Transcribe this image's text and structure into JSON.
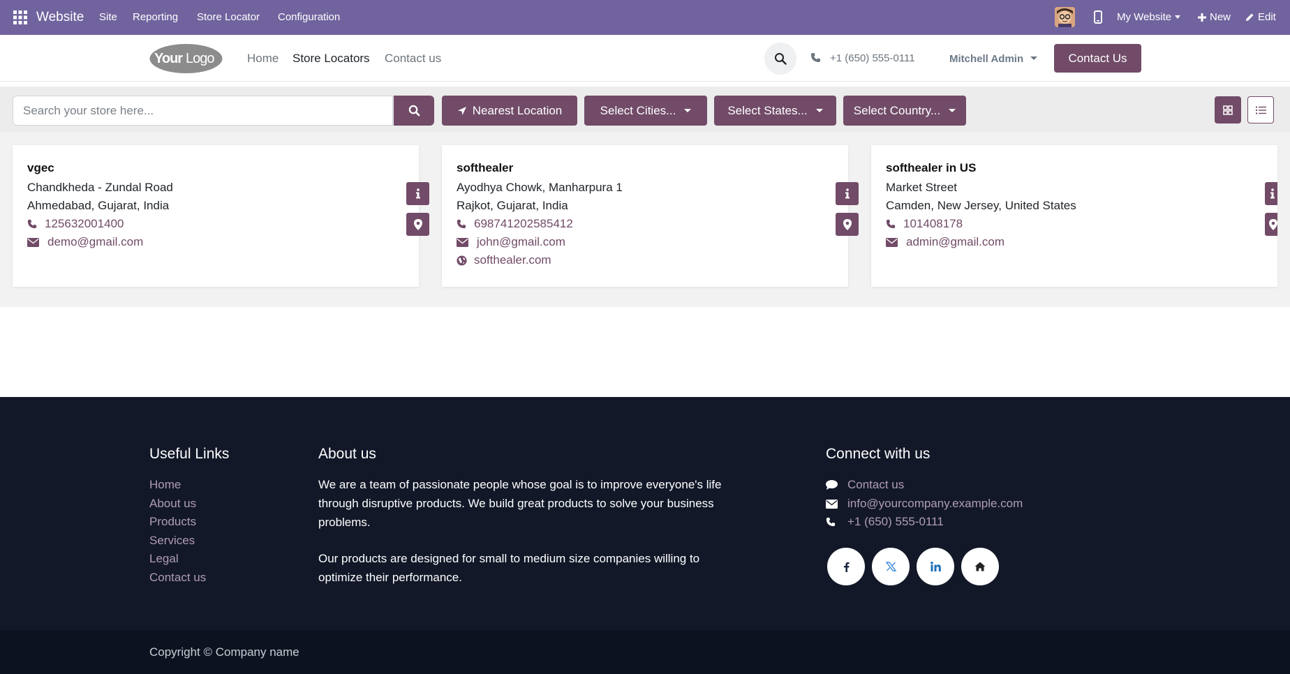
{
  "topbar": {
    "app_name": "Website",
    "menu": [
      "Site",
      "Reporting",
      "Store Locator",
      "Configuration"
    ],
    "website_selector": "My Website",
    "new_label": "New",
    "edit_label": "Edit",
    "bg_color": "#71639e"
  },
  "header": {
    "logo_text": "YourLogo",
    "nav": [
      "Home",
      "Store Locators",
      "Contact us"
    ],
    "active_nav": "Store Locators",
    "phone": "+1 (650) 555-0111",
    "user": "Mitchell Admin",
    "contact_button": "Contact Us"
  },
  "filters": {
    "search_placeholder": "Search your store here...",
    "nearest_label": "Nearest Location",
    "cities_label": "Select Cities...",
    "states_label": "Select States...",
    "country_label": "Select Country..."
  },
  "stores": [
    {
      "name": "vgec",
      "street": "Chandkheda - Zundal Road",
      "city_line": "Ahmedabad, Gujarat, India",
      "phone": "125632001400",
      "email": "demo@gmail.com"
    },
    {
      "name": "softhealer",
      "street": "Ayodhya Chowk, Manharpura 1",
      "city_line": "Rajkot, Gujarat, India",
      "phone": "698741202585412",
      "email": "john@gmail.com",
      "website": "softhealer.com"
    },
    {
      "name": "softhealer in US",
      "street": "Market Street",
      "city_line": "Camden, New Jersey, United States",
      "phone": "101408178",
      "email": "admin@gmail.com"
    }
  ],
  "footer": {
    "useful_links_title": "Useful Links",
    "useful_links": [
      "Home",
      "About us",
      "Products",
      "Services",
      "Legal",
      "Contact us"
    ],
    "about_title": "About us",
    "about_p1": "We are a team of passionate people whose goal is to improve everyone's life through disruptive products. We build great products to solve your business problems.",
    "about_p2": "Our products are designed for small to medium size companies willing to optimize their performance.",
    "connect_title": "Connect with us",
    "connect_contact": "Contact us",
    "connect_email": "info@yourcompany.example.com",
    "connect_phone": "+1 (650) 555-0111",
    "social_icons": [
      "facebook-icon",
      "x-twitter-icon",
      "linkedin-icon",
      "home-icon"
    ],
    "copyright": "Copyright © Company name"
  },
  "colors": {
    "primary": "#714b67",
    "footer_bg": "#121828",
    "footer_link": "#b19db4"
  }
}
